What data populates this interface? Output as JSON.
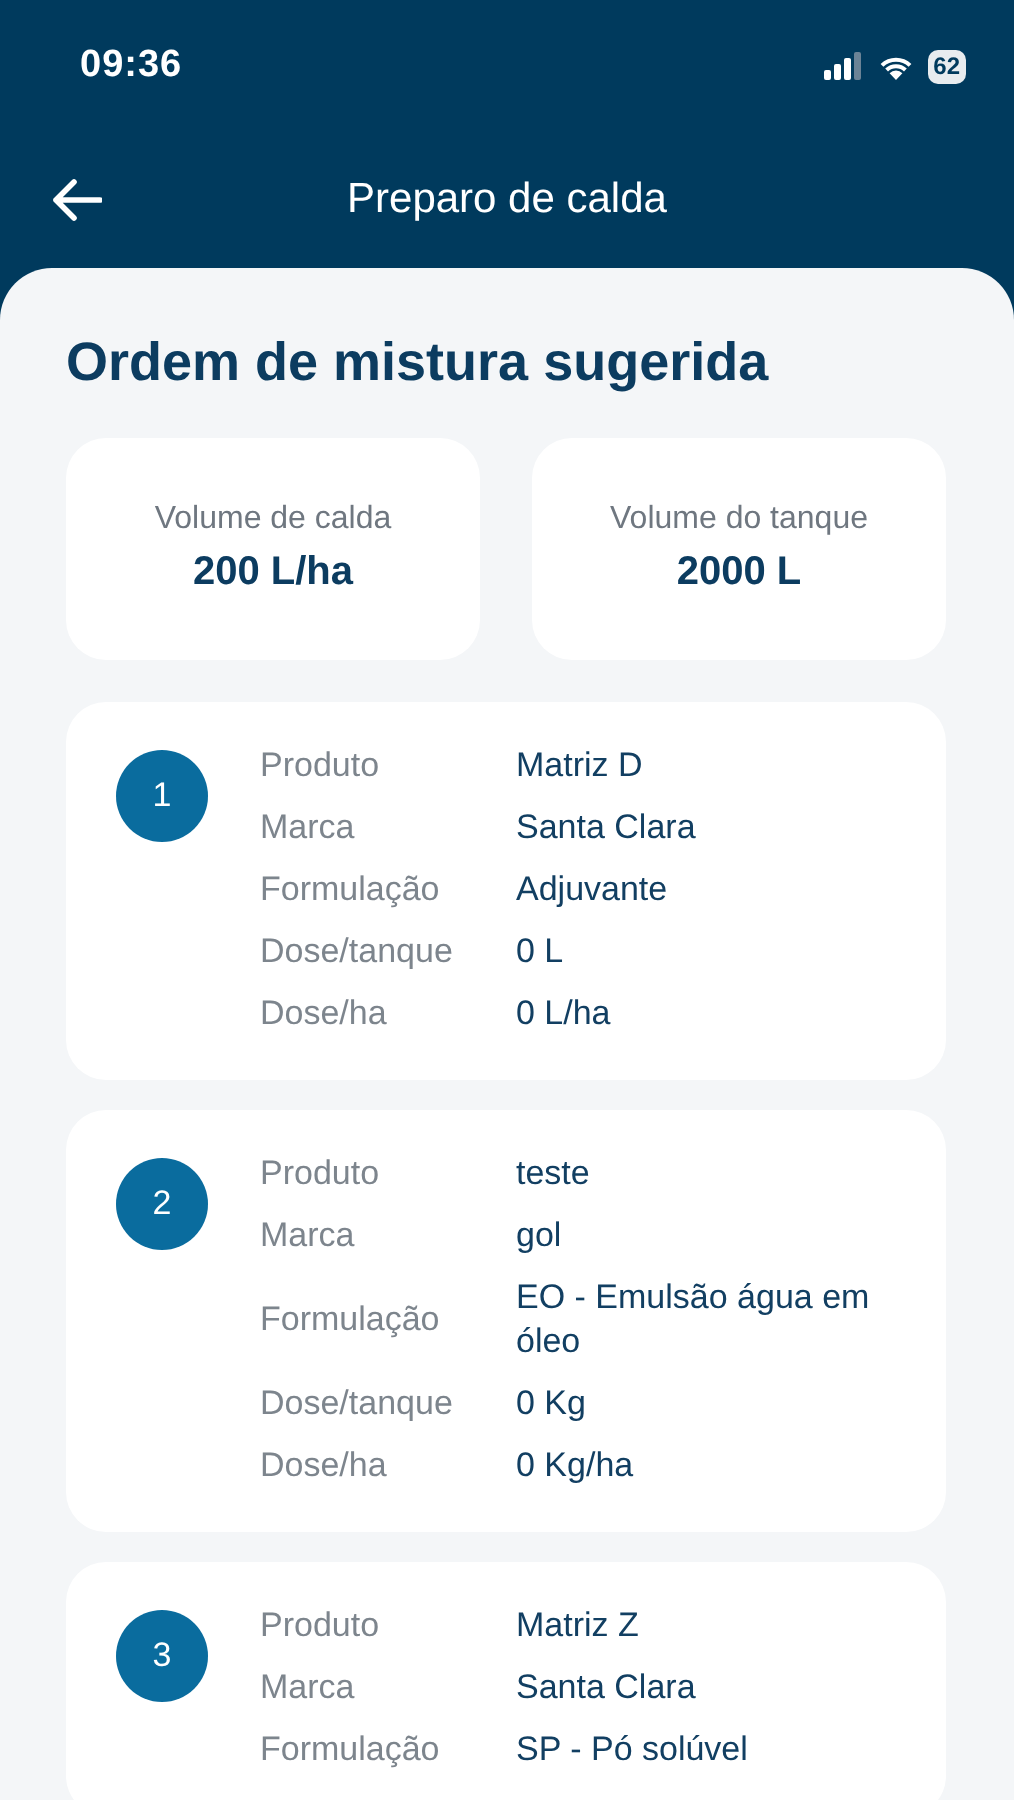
{
  "status_bar": {
    "time": "09:36",
    "battery": "62"
  },
  "header": {
    "title": "Preparo de calda"
  },
  "title": "Ordem de mistura sugerida",
  "summary": [
    {
      "label": "Volume de calda",
      "value": "200 L/ha"
    },
    {
      "label": "Volume do tanque",
      "value": "2000 L"
    }
  ],
  "products": [
    {
      "number": "1",
      "fields": [
        {
          "label": "Produto",
          "value": "Matriz D"
        },
        {
          "label": "Marca",
          "value": "Santa Clara"
        },
        {
          "label": "Formulação",
          "value": "Adjuvante"
        },
        {
          "label": "Dose/tanque",
          "value": "0 L"
        },
        {
          "label": "Dose/ha",
          "value": "0 L/ha"
        }
      ]
    },
    {
      "number": "2",
      "fields": [
        {
          "label": "Produto",
          "value": "teste"
        },
        {
          "label": "Marca",
          "value": "gol"
        },
        {
          "label": "Formulação",
          "value": "EO - Emulsão água em óleo"
        },
        {
          "label": "Dose/tanque",
          "value": "0 Kg"
        },
        {
          "label": "Dose/ha",
          "value": "0 Kg/ha"
        }
      ]
    },
    {
      "number": "3",
      "fields": [
        {
          "label": "Produto",
          "value": "Matriz Z"
        },
        {
          "label": "Marca",
          "value": "Santa Clara"
        },
        {
          "label": "Formulação",
          "value": "SP - Pó solúvel"
        }
      ]
    }
  ]
}
